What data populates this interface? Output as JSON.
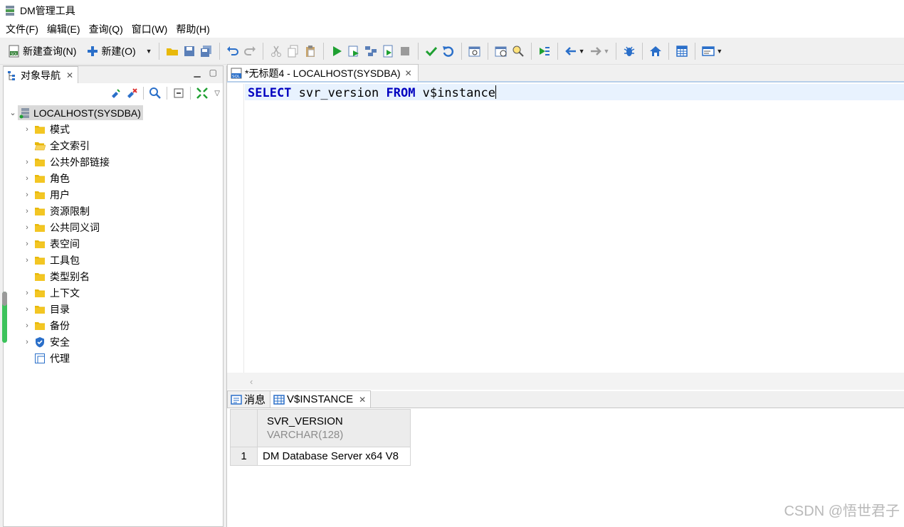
{
  "window": {
    "title": "DM管理工具"
  },
  "menu": [
    "文件(F)",
    "编辑(E)",
    "查询(Q)",
    "窗口(W)",
    "帮助(H)"
  ],
  "toolbar": {
    "new_query_label": "新建查询(N)",
    "new_label": "新建(O)"
  },
  "navigator": {
    "tab_label": "对象导航",
    "root_label": "LOCALHOST(SYSDBA)",
    "items": [
      {
        "label": "模式",
        "expandable": true,
        "icon": "folder-icon"
      },
      {
        "label": "全文索引",
        "expandable": false,
        "icon": "folder-open-icon"
      },
      {
        "label": "公共外部链接",
        "expandable": true,
        "icon": "folder-icon"
      },
      {
        "label": "角色",
        "expandable": true,
        "icon": "folder-icon"
      },
      {
        "label": "用户",
        "expandable": true,
        "icon": "folder-icon"
      },
      {
        "label": "资源限制",
        "expandable": true,
        "icon": "folder-icon"
      },
      {
        "label": "公共同义词",
        "expandable": true,
        "icon": "folder-icon"
      },
      {
        "label": "表空间",
        "expandable": true,
        "icon": "folder-icon"
      },
      {
        "label": "工具包",
        "expandable": true,
        "icon": "folder-icon"
      },
      {
        "label": "类型别名",
        "expandable": false,
        "icon": "folder-icon"
      },
      {
        "label": "上下文",
        "expandable": true,
        "icon": "folder-icon"
      },
      {
        "label": "目录",
        "expandable": true,
        "icon": "folder-icon"
      },
      {
        "label": "备份",
        "expandable": true,
        "icon": "folder-icon"
      },
      {
        "label": "安全",
        "expandable": true,
        "icon": "shield-icon"
      },
      {
        "label": "代理",
        "expandable": false,
        "icon": "proxy-icon"
      }
    ]
  },
  "editor": {
    "tab_label": "*无标题4 - LOCALHOST(SYSDBA)",
    "sql": {
      "kw1": "SELECT",
      "part1": " svr_version ",
      "kw2": "FROM",
      "part2": " v$instance"
    }
  },
  "results": {
    "tabs": [
      {
        "label": "消息",
        "active": false
      },
      {
        "label": "V$INSTANCE",
        "active": true
      }
    ],
    "columns": [
      {
        "name": "SVR_VERSION",
        "type": "VARCHAR(128)"
      }
    ],
    "rows": [
      {
        "num": "1",
        "values": [
          "DM Database Server x64 V8"
        ]
      }
    ]
  },
  "watermark": "CSDN @悟世君子",
  "colors": {
    "keyword": "#0000c0",
    "current_line": "#e8f2fe",
    "folder": "#e8b90a",
    "run_green": "#1fa032",
    "arrow_blue": "#2a6fc9"
  }
}
